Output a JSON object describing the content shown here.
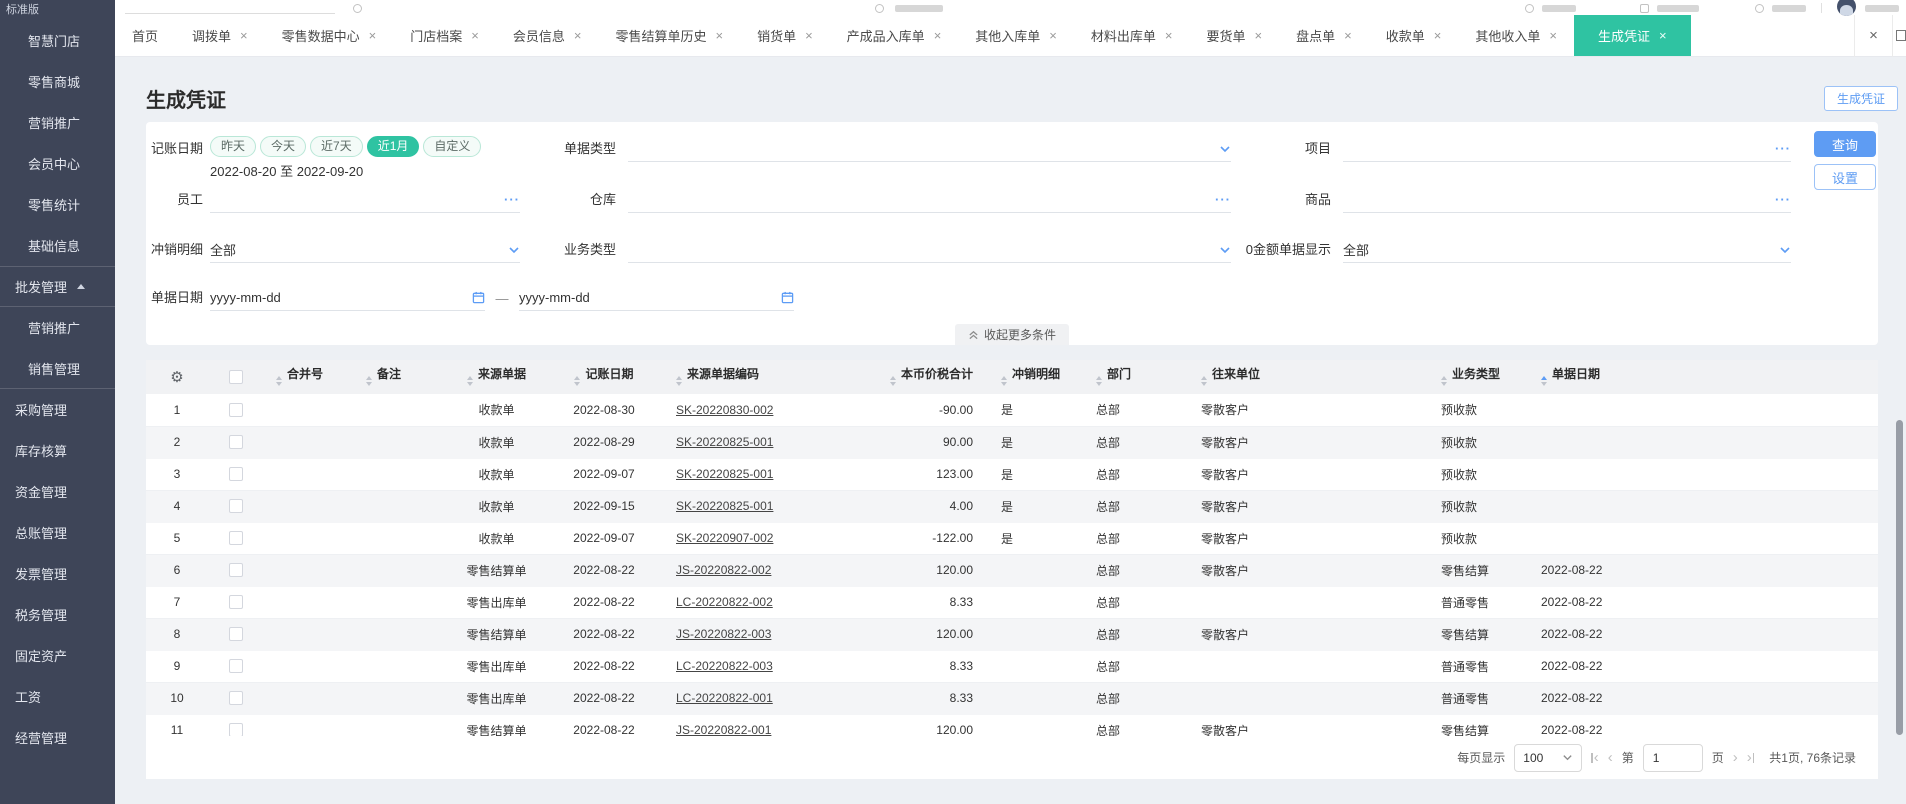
{
  "colors": {
    "accent_green": "#2fc3a2",
    "accent_blue": "#5e9cf3",
    "sidebar_bg": "#3e4558"
  },
  "sidebar": {
    "version": "标准版",
    "items": [
      {
        "name": "smart-store",
        "label": "智慧门店",
        "type": "child"
      },
      {
        "name": "retail-mall",
        "label": "零售商城",
        "type": "child"
      },
      {
        "name": "marketing",
        "label": "营销推广",
        "type": "child"
      },
      {
        "name": "member-center",
        "label": "会员中心",
        "type": "child"
      },
      {
        "name": "retail-stats",
        "label": "零售统计",
        "type": "child"
      },
      {
        "name": "basic-info",
        "label": "基础信息",
        "type": "child"
      },
      {
        "name": "wholesale-mgmt",
        "label": "批发管理",
        "type": "section",
        "expanded": true,
        "divider_before": true,
        "divider_after": true
      },
      {
        "name": "marketing-promo",
        "label": "营销推广",
        "type": "child"
      },
      {
        "name": "sales-mgmt",
        "label": "销售管理",
        "type": "child",
        "divider_after": true
      },
      {
        "name": "purchase-mgmt",
        "label": "采购管理",
        "type": "section"
      },
      {
        "name": "inventory-accounting",
        "label": "库存核算",
        "type": "section"
      },
      {
        "name": "funds-mgmt",
        "label": "资金管理",
        "type": "section"
      },
      {
        "name": "general-ledger",
        "label": "总账管理",
        "type": "section"
      },
      {
        "name": "invoice-mgmt",
        "label": "发票管理",
        "type": "section"
      },
      {
        "name": "tax-mgmt",
        "label": "税务管理",
        "type": "section"
      },
      {
        "name": "fixed-assets",
        "label": "固定资产",
        "type": "section"
      },
      {
        "name": "payroll",
        "label": "工资",
        "type": "section"
      },
      {
        "name": "business-mgmt",
        "label": "经营管理",
        "type": "section"
      }
    ]
  },
  "tabbar": {
    "close_all_label": "×",
    "tabs": [
      {
        "name": "home",
        "label": "首页",
        "closable": false,
        "active": false
      },
      {
        "name": "transfer-order",
        "label": "调拨单",
        "closable": true,
        "active": false
      },
      {
        "name": "retail-data-center",
        "label": "零售数据中心",
        "closable": true,
        "active": false
      },
      {
        "name": "store-archives",
        "label": "门店档案",
        "closable": true,
        "active": false
      },
      {
        "name": "member-info",
        "label": "会员信息",
        "closable": true,
        "active": false
      },
      {
        "name": "retail-settlement-history",
        "label": "零售结算单历史",
        "closable": true,
        "active": false
      },
      {
        "name": "sales-order",
        "label": "销货单",
        "closable": true,
        "active": false
      },
      {
        "name": "finished-goods-inbound",
        "label": "产成品入库单",
        "closable": true,
        "active": false
      },
      {
        "name": "other-inbound",
        "label": "其他入库单",
        "closable": true,
        "active": false
      },
      {
        "name": "material-outbound",
        "label": "材料出库单",
        "closable": true,
        "active": false
      },
      {
        "name": "goods-request",
        "label": "要货单",
        "closable": true,
        "active": false
      },
      {
        "name": "stocktaking",
        "label": "盘点单",
        "closable": true,
        "active": false
      },
      {
        "name": "receipt",
        "label": "收款单",
        "closable": true,
        "active": false
      },
      {
        "name": "other-income",
        "label": "其他收入单",
        "closable": true,
        "active": false
      },
      {
        "name": "generate-voucher",
        "label": "生成凭证",
        "closable": true,
        "active": true
      }
    ]
  },
  "page": {
    "title": "生成凭证",
    "generate_button": "生成凭证"
  },
  "filters": {
    "accounting_date": {
      "label": "记账日期",
      "presets": [
        "昨天",
        "今天",
        "近7天",
        "近1月",
        "自定义"
      ],
      "active_preset": "近1月",
      "range_text": "2022-08-20 至 2022-09-20"
    },
    "doc_type": {
      "label": "单据类型",
      "value": ""
    },
    "project": {
      "label": "项目",
      "value": ""
    },
    "employee": {
      "label": "员工",
      "value": ""
    },
    "warehouse": {
      "label": "仓库",
      "value": ""
    },
    "goods": {
      "label": "商品",
      "value": ""
    },
    "writeoff_detail": {
      "label": "冲销明细",
      "value": "全部"
    },
    "business_type": {
      "label": "业务类型",
      "value": ""
    },
    "zero_amount_display": {
      "label": "0金额单据显示",
      "value": "全部"
    },
    "doc_date": {
      "label": "单据日期",
      "start_placeholder": "yyyy-mm-dd",
      "end_placeholder": "yyyy-mm-dd",
      "separator": "—"
    },
    "search_button": "查询",
    "settings_button": "设置",
    "collapse_label": "收起更多条件"
  },
  "table": {
    "columns": [
      {
        "name": "merge-no",
        "label": "合并号",
        "align": "l",
        "sorted": false
      },
      {
        "name": "note",
        "label": "备注",
        "align": "l",
        "sorted": false
      },
      {
        "name": "source-doc",
        "label": "来源单据",
        "align": "c",
        "sorted": false
      },
      {
        "name": "accounting-date",
        "label": "记账日期",
        "align": "c",
        "sorted": false
      },
      {
        "name": "source-doc-code",
        "label": "来源单据编码",
        "align": "l",
        "sorted": false
      },
      {
        "name": "total-amount",
        "label": "本币价税合计",
        "align": "r",
        "sorted": false
      },
      {
        "name": "writeoff-detail",
        "label": "冲销明细",
        "align": "l",
        "sorted": false
      },
      {
        "name": "department",
        "label": "部门",
        "align": "l",
        "sorted": false
      },
      {
        "name": "partner",
        "label": "往来单位",
        "align": "l",
        "sorted": false
      },
      {
        "name": "business-type",
        "label": "业务类型",
        "align": "l",
        "sorted": false
      },
      {
        "name": "doc-date",
        "label": "单据日期",
        "align": "l",
        "sorted": true
      }
    ],
    "rows": [
      {
        "no": 1,
        "merge_no": "",
        "note": "",
        "source_doc": "收款单",
        "accounting_date": "2022-08-30",
        "source_code": "SK-20220830-002",
        "amount": "-90.00",
        "writeoff": "是",
        "department": "总部",
        "partner": "零散客户",
        "business_type": "预收款",
        "doc_date": ""
      },
      {
        "no": 2,
        "merge_no": "",
        "note": "",
        "source_doc": "收款单",
        "accounting_date": "2022-08-29",
        "source_code": "SK-20220825-001",
        "amount": "90.00",
        "writeoff": "是",
        "department": "总部",
        "partner": "零散客户",
        "business_type": "预收款",
        "doc_date": ""
      },
      {
        "no": 3,
        "merge_no": "",
        "note": "",
        "source_doc": "收款单",
        "accounting_date": "2022-09-07",
        "source_code": "SK-20220825-001",
        "amount": "123.00",
        "writeoff": "是",
        "department": "总部",
        "partner": "零散客户",
        "business_type": "预收款",
        "doc_date": ""
      },
      {
        "no": 4,
        "merge_no": "",
        "note": "",
        "source_doc": "收款单",
        "accounting_date": "2022-09-15",
        "source_code": "SK-20220825-001",
        "amount": "4.00",
        "writeoff": "是",
        "department": "总部",
        "partner": "零散客户",
        "business_type": "预收款",
        "doc_date": ""
      },
      {
        "no": 5,
        "merge_no": "",
        "note": "",
        "source_doc": "收款单",
        "accounting_date": "2022-09-07",
        "source_code": "SK-20220907-002",
        "amount": "-122.00",
        "writeoff": "是",
        "department": "总部",
        "partner": "零散客户",
        "business_type": "预收款",
        "doc_date": ""
      },
      {
        "no": 6,
        "merge_no": "",
        "note": "",
        "source_doc": "零售结算单",
        "accounting_date": "2022-08-22",
        "source_code": "JS-20220822-002",
        "amount": "120.00",
        "writeoff": "",
        "department": "总部",
        "partner": "零散客户",
        "business_type": "零售结算",
        "doc_date": "2022-08-22"
      },
      {
        "no": 7,
        "merge_no": "",
        "note": "",
        "source_doc": "零售出库单",
        "accounting_date": "2022-08-22",
        "source_code": "LC-20220822-002",
        "amount": "8.33",
        "writeoff": "",
        "department": "总部",
        "partner": "",
        "business_type": "普通零售",
        "doc_date": "2022-08-22"
      },
      {
        "no": 8,
        "merge_no": "",
        "note": "",
        "source_doc": "零售结算单",
        "accounting_date": "2022-08-22",
        "source_code": "JS-20220822-003",
        "amount": "120.00",
        "writeoff": "",
        "department": "总部",
        "partner": "零散客户",
        "business_type": "零售结算",
        "doc_date": "2022-08-22"
      },
      {
        "no": 9,
        "merge_no": "",
        "note": "",
        "source_doc": "零售出库单",
        "accounting_date": "2022-08-22",
        "source_code": "LC-20220822-003",
        "amount": "8.33",
        "writeoff": "",
        "department": "总部",
        "partner": "",
        "business_type": "普通零售",
        "doc_date": "2022-08-22"
      },
      {
        "no": 10,
        "merge_no": "",
        "note": "",
        "source_doc": "零售出库单",
        "accounting_date": "2022-08-22",
        "source_code": "LC-20220822-001",
        "amount": "8.33",
        "writeoff": "",
        "department": "总部",
        "partner": "",
        "business_type": "普通零售",
        "doc_date": "2022-08-22"
      },
      {
        "no": 11,
        "merge_no": "",
        "note": "",
        "source_doc": "零售结算单",
        "accounting_date": "2022-08-22",
        "source_code": "JS-20220822-001",
        "amount": "120.00",
        "writeoff": "",
        "department": "总部",
        "partner": "零散客户",
        "business_type": "零售结算",
        "doc_date": "2022-08-22"
      }
    ]
  },
  "pagination": {
    "per_page_label": "每页显示",
    "per_page_value": "100",
    "page_prefix": "第",
    "current_page": "1",
    "page_suffix": "页",
    "summary": "共1页, 76条记录"
  }
}
